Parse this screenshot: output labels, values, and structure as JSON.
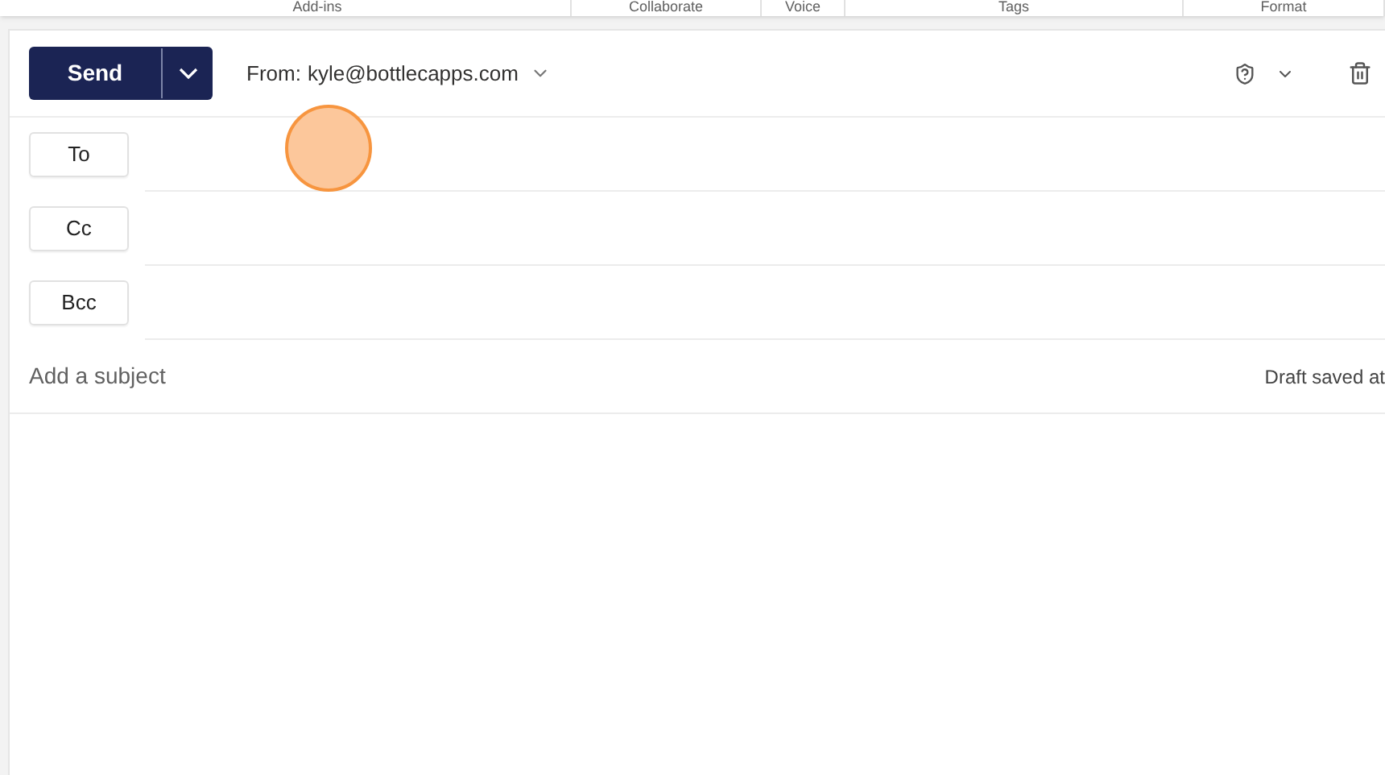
{
  "ribbon_groups": [
    "Add-ins",
    "Collaborate",
    "Voice",
    "Tags",
    "Format"
  ],
  "send_button": {
    "label": "Send"
  },
  "from": {
    "label": "From:",
    "address": "kyle@bottlecapps.com"
  },
  "recipients": [
    {
      "label": "To"
    },
    {
      "label": "Cc"
    },
    {
      "label": "Bcc"
    }
  ],
  "subject": {
    "placeholder": "Add a subject"
  },
  "draft_status": "Draft saved at"
}
